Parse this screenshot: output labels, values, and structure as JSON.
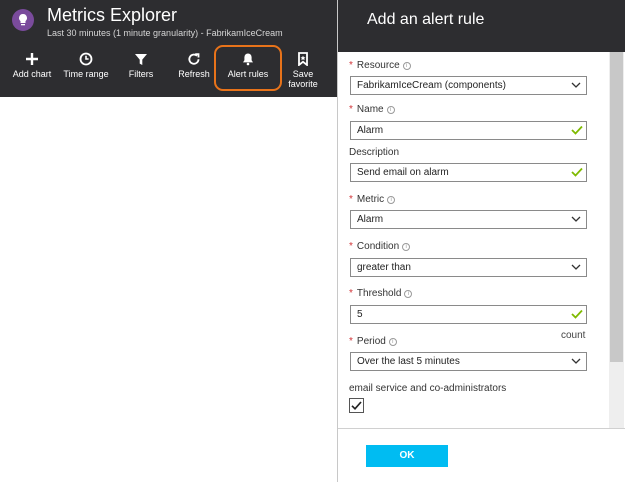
{
  "metrics_explorer": {
    "title": "Metrics Explorer",
    "subtitle": "Last 30 minutes (1 minute granularity) - FabrikamIceCream",
    "toolbar": {
      "add_chart": "Add chart",
      "time_range": "Time range",
      "filters": "Filters",
      "refresh": "Refresh",
      "alert_rules": "Alert rules",
      "save_favorite_line1": "Save",
      "save_favorite_line2": "favorite"
    },
    "highlight_color": "#e8731a"
  },
  "alert_blade": {
    "title": "Add an alert rule",
    "resource": {
      "label": "Resource",
      "value": "FabrikamIceCream (components)"
    },
    "name": {
      "label": "Name",
      "value": "Alarm"
    },
    "description": {
      "label": "Description",
      "value": "Send email on alarm"
    },
    "metric": {
      "label": "Metric",
      "value": "Alarm"
    },
    "condition": {
      "label": "Condition",
      "value": "greater than"
    },
    "threshold": {
      "label": "Threshold",
      "value": "5",
      "unit": "count"
    },
    "period": {
      "label": "Period",
      "value": "Over the last 5 minutes"
    },
    "email_label": "email service and co-administrators",
    "email_checked": true,
    "ok_label": "OK",
    "accent_color": "#00bcf2",
    "required_color": "#d13438",
    "valid_color": "#7fba00"
  }
}
